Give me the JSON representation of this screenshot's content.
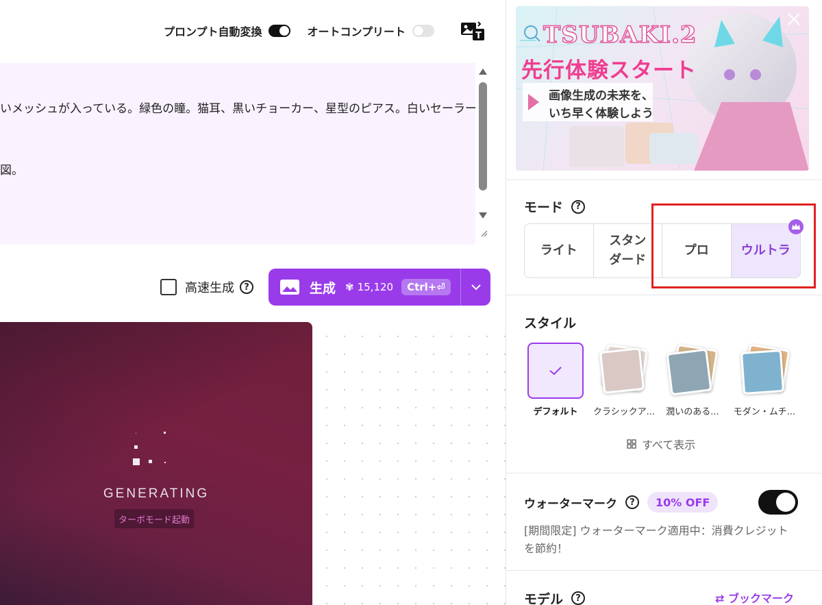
{
  "topbar": {
    "prompt_convert_label": "プロンプト自動変換",
    "prompt_convert_on": true,
    "autocomplete_label": "オートコンプリート",
    "autocomplete_on": false,
    "img_text_icon": "image-to-text-icon"
  },
  "prompt": {
    "line1": "いメッシュが入っている。緑色の瞳。猫耳、黒いチョーカー、星型のピアス。白いセーラー服",
    "line2": "図。"
  },
  "generate": {
    "fast_label": "高速生成",
    "fast_checked": false,
    "button_label": "生成",
    "credits": "15,120",
    "shortcut": "Ctrl+⏎",
    "accent": "#9a3bea"
  },
  "canvas": {
    "status": "GENERATING",
    "turbo_label": "ターボモード起動"
  },
  "banner": {
    "title": "TSUBAKI.2",
    "subtitle": "先行体験スタート",
    "tagline1": "画像生成の未来を、",
    "tagline2": "いち早く体験しよう"
  },
  "mode": {
    "title": "モード",
    "options": [
      "ライト",
      "スタンダード",
      "プロ",
      "ウルトラ"
    ],
    "option_lines": [
      [
        "ライト"
      ],
      [
        "スタン",
        "ダード"
      ],
      [
        "プロ"
      ],
      [
        "ウルトラ"
      ]
    ],
    "selected": "ウルトラ"
  },
  "style": {
    "title": "スタイル",
    "items": [
      "デフォルト",
      "クラシックア...",
      "潤いのある...",
      "モダン・ムチ..."
    ],
    "selected": "デフォルト",
    "show_all": "すべて表示"
  },
  "watermark": {
    "title": "ウォーターマーク",
    "badge": "10% OFF",
    "on": true,
    "note": "[期間限定] ウォーターマーク適用中：消費クレジットを節約！"
  },
  "model": {
    "title": "モデル",
    "bookmark": "ブックマーク"
  }
}
